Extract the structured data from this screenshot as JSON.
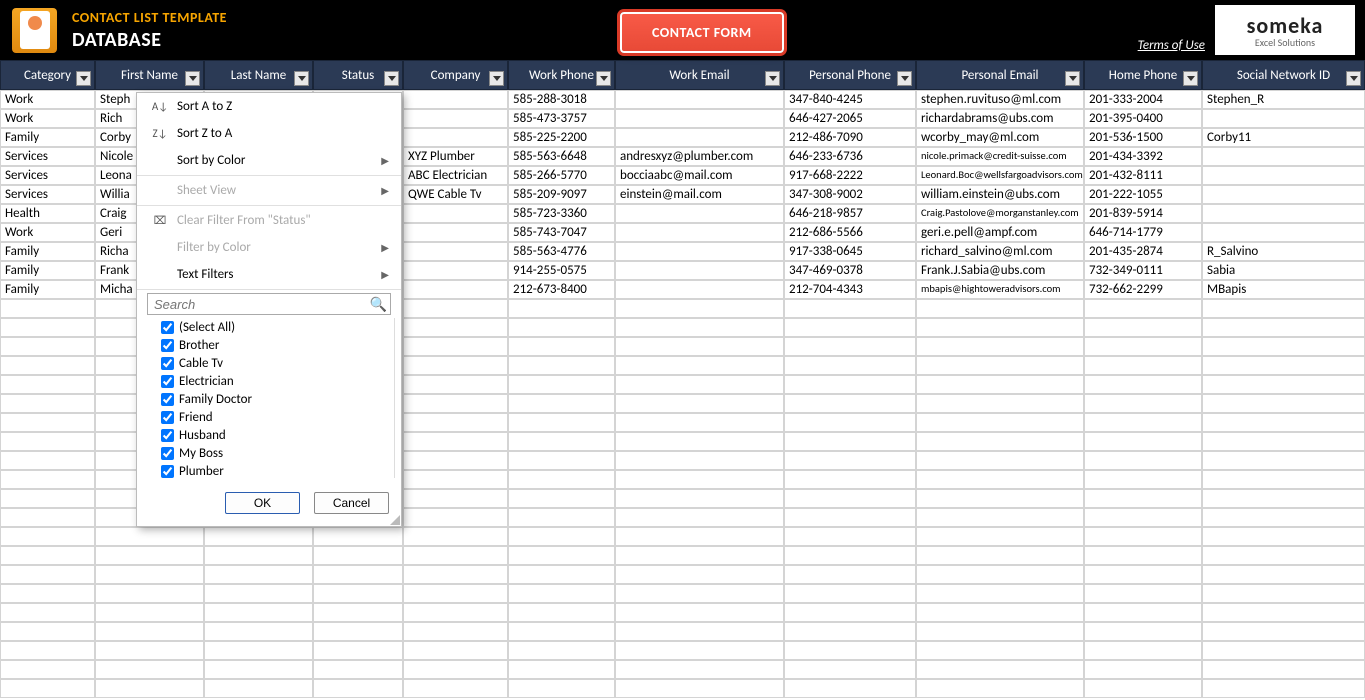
{
  "header": {
    "title1": "CONTACT LIST TEMPLATE",
    "title2": "DATABASE",
    "contact_button": "CONTACT FORM",
    "terms": "Terms of Use",
    "brand": "someka",
    "brand_sub": "Excel Solutions"
  },
  "columns": [
    "Category",
    "First Name",
    "Last Name",
    "Status",
    "Company",
    "Work Phone",
    "Work Email",
    "Personal Phone",
    "Personal Email",
    "Home Phone",
    "Social Network ID"
  ],
  "rows": [
    {
      "category": "Work",
      "first": "Steph",
      "company": "",
      "wphone": "585-288-3018",
      "wemail": "",
      "pphone": "347-840-4245",
      "pemail": "stephen.ruvituso@ml.com",
      "hphone": "201-333-2004",
      "social": "Stephen_R"
    },
    {
      "category": "Work",
      "first": "Rich",
      "company": "",
      "wphone": "585-473-3757",
      "wemail": "",
      "pphone": "646-427-2065",
      "pemail": "richardabrams@ubs.com",
      "hphone": "201-395-0400",
      "social": ""
    },
    {
      "category": "Family",
      "first": "Corby",
      "company": "",
      "wphone": "585-225-2200",
      "wemail": "",
      "pphone": "212-486-7090",
      "pemail": "wcorby_may@ml.com",
      "hphone": "201-536-1500",
      "social": "Corby11"
    },
    {
      "category": "Services",
      "first": "Nicole",
      "company": "XYZ Plumber",
      "wphone": "585-563-6648",
      "wemail": "andresxyz@plumber.com",
      "pphone": "646-233-6736",
      "pemail": "nicole.primack@credit-suisse.com",
      "pemail_sm": true,
      "hphone": "201-434-3392",
      "social": ""
    },
    {
      "category": "Services",
      "first": "Leona",
      "company": "ABC Electrician",
      "wphone": "585-266-5770",
      "wemail": "bocciaabc@mail.com",
      "pphone": "917-668-2222",
      "pemail": "Leonard.Boc@wellsfargoadvisors.com",
      "pemail_sm": true,
      "hphone": "201-432-8111",
      "social": ""
    },
    {
      "category": "Services",
      "first": "Willia",
      "company": "QWE Cable Tv",
      "wphone": "585-209-9097",
      "wemail": "einstein@mail.com",
      "pphone": "347-308-9002",
      "pemail": "william.einstein@ubs.com",
      "hphone": "201-222-1055",
      "social": ""
    },
    {
      "category": "Health",
      "first": "Craig",
      "company": "",
      "wphone": "585-723-3360",
      "wemail": "",
      "pphone": "646-218-9857",
      "pemail": "Craig.Pastolove@morganstanley.com",
      "pemail_sm": true,
      "hphone": "201-839-5914",
      "social": ""
    },
    {
      "category": "Work",
      "first": "Geri",
      "company": "",
      "wphone": "585-743-7047",
      "wemail": "",
      "pphone": "212-686-5566",
      "pemail": "geri.e.pell@ampf.com",
      "hphone": "646-714-1779",
      "social": ""
    },
    {
      "category": "Family",
      "first": "Richa",
      "company": "",
      "wphone": "585-563-4776",
      "wemail": "",
      "pphone": "917-338-0645",
      "pemail": "richard_salvino@ml.com",
      "hphone": "201-435-2874",
      "social": "R_Salvino"
    },
    {
      "category": "Family",
      "first": "Frank",
      "company": "",
      "wphone": "914-255-0575",
      "wemail": "",
      "pphone": "347-469-0378",
      "pemail": "Frank.J.Sabia@ubs.com",
      "hphone": "732-349-0111",
      "social": "Sabia"
    },
    {
      "category": "Family",
      "first": "Micha",
      "company": "",
      "wphone": "212-673-8400",
      "wemail": "",
      "pphone": "212-704-4343",
      "pemail": "mbapis@hightoweradvisors.com",
      "pemail_sm": true,
      "hphone": "732-662-2299",
      "social": "MBapis"
    }
  ],
  "menu": {
    "sort_az": "Sort A to Z",
    "sort_za": "Sort Z to A",
    "sort_color": "Sort by Color",
    "sheet_view": "Sheet View",
    "clear_filter": "Clear Filter From \"Status\"",
    "filter_color": "Filter by Color",
    "text_filters": "Text Filters",
    "search_placeholder": "Search",
    "ok": "OK",
    "cancel": "Cancel",
    "items": [
      "(Select All)",
      "Brother",
      "Cable Tv",
      "Electrician",
      "Family Doctor",
      "Friend",
      "Husband",
      "My Boss",
      "Plumber"
    ]
  }
}
